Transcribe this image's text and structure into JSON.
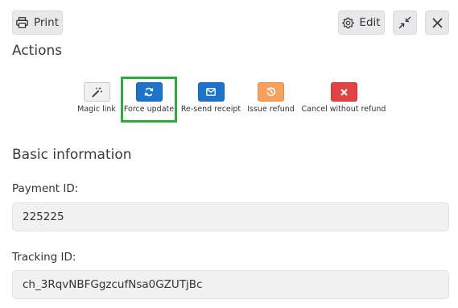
{
  "toolbar": {
    "print_label": "Print",
    "edit_label": "Edit"
  },
  "actions": {
    "title": "Actions",
    "items": [
      {
        "label": "Magic link",
        "icon": "magic-wand-icon",
        "color": "#f1f1f1"
      },
      {
        "label": "Force update",
        "icon": "refresh-icon",
        "color": "#1c73c9"
      },
      {
        "label": "Re-send receipt",
        "icon": "envelope-icon",
        "color": "#1c73c9"
      },
      {
        "label": "Issue refund",
        "icon": "history-icon",
        "color": "#f5a15f"
      },
      {
        "label": "Cancel without refund",
        "icon": "close-icon",
        "color": "#e04343"
      }
    ],
    "highlight_color": "#2eab3a"
  },
  "basic": {
    "title": "Basic information",
    "payment_id_label": "Payment ID:",
    "payment_id_value": "225225",
    "tracking_id_label": "Tracking ID:",
    "tracking_id_value": "ch_3RqvNBFGgzcufNsa0GZUTjBc"
  }
}
